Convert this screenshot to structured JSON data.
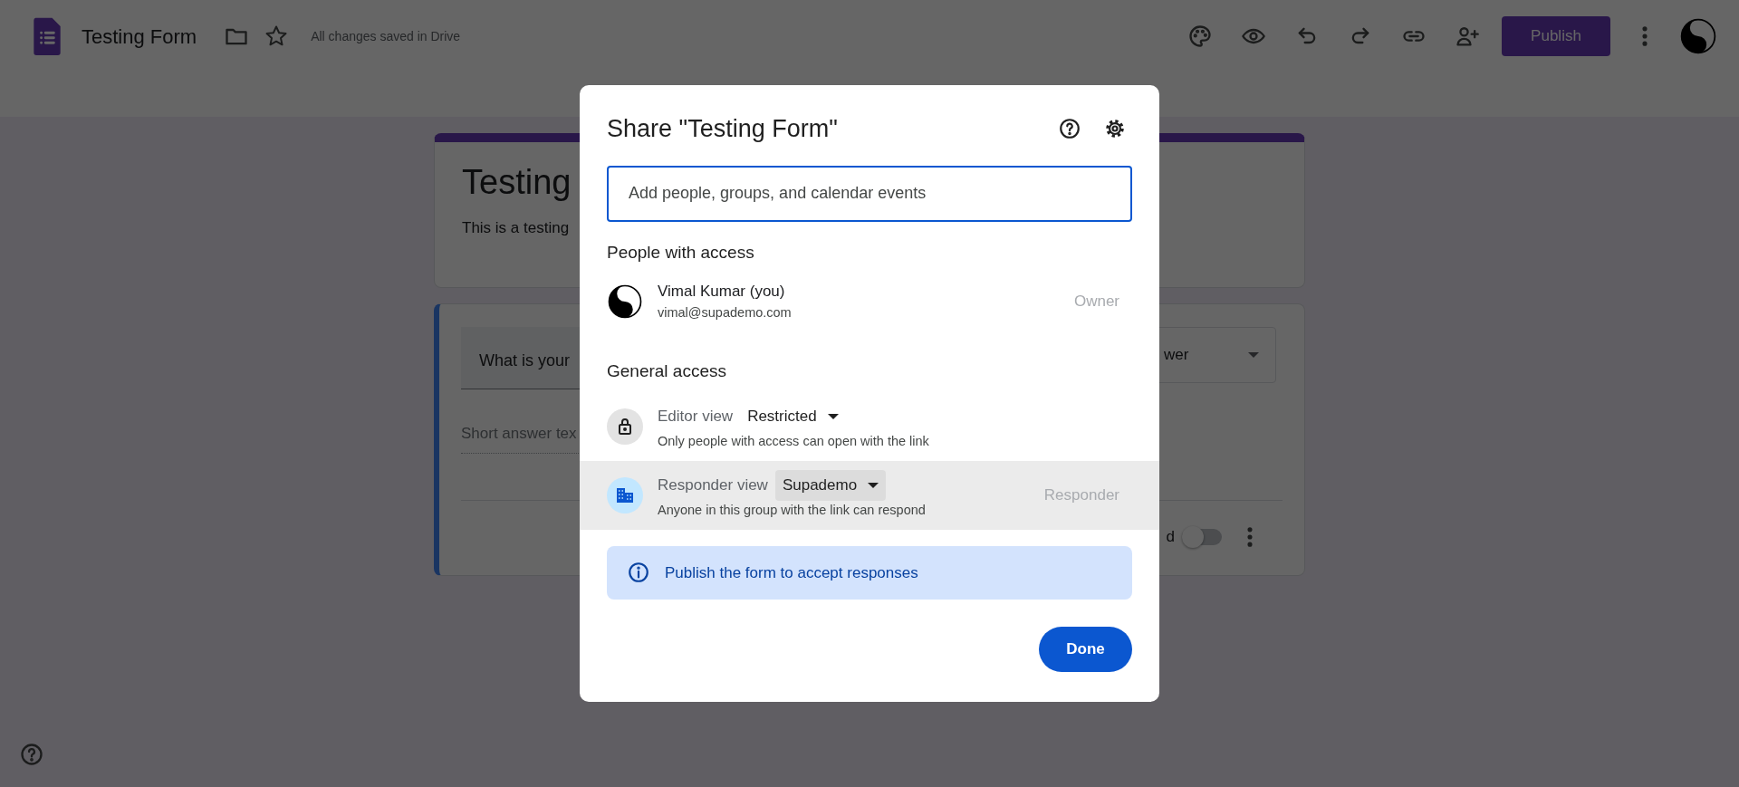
{
  "app_bar": {
    "title": "Testing Form",
    "save_status": "All changes saved in Drive",
    "publish_label": "Publish"
  },
  "form": {
    "title": "Testing",
    "description": "This is a testing",
    "question": {
      "title": "What is your",
      "answer_placeholder": "Short answer tex",
      "type_label": "wer",
      "required_label": "d",
      "required": false
    }
  },
  "dialog": {
    "title": "Share \"Testing Form\"",
    "add_placeholder": "Add people, groups, and calendar events",
    "people_heading": "People with access",
    "people": [
      {
        "name": "Vimal Kumar (you)",
        "email": "vimal@supademo.com",
        "role": "Owner"
      }
    ],
    "general_heading": "General access",
    "access_rows": [
      {
        "kind": "editor",
        "label": "Editor view",
        "value": "Restricted",
        "description": "Only people with access can open with the link",
        "highlighted": false
      },
      {
        "kind": "responder",
        "label": "Responder view",
        "value": "Supademo",
        "description": "Anyone in this group with the link can respond",
        "role": "Responder",
        "highlighted": true
      }
    ],
    "notice": "Publish the form to accept responses",
    "done_label": "Done"
  }
}
